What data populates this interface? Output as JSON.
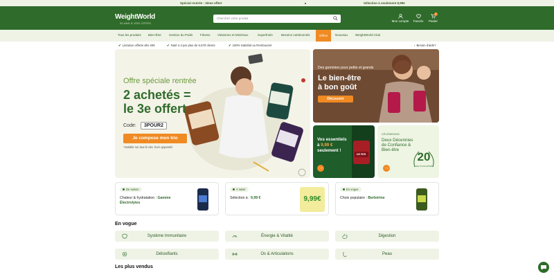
{
  "topbar": {
    "left": "Spécial rentrée : 3ème offert",
    "right": "Sélection à seulement 9,99€"
  },
  "header": {
    "logo": "WeightWorld",
    "logo_sub": "20 ANS À VOS CÔTÉS",
    "search_placeholder": "Cherchez votre produit",
    "account": "Mon compte",
    "favorites": "Favoris",
    "cart": "Panier",
    "cart_count": "0"
  },
  "nav": {
    "items": [
      "Tous les produits",
      "Bien-Être",
      "Gestion du Poids",
      "Fitness",
      "Vitamines et Minéraux",
      "Superfruits",
      "Besoins nutritionnels",
      "Offres",
      "Nouveau",
      "WeightWorld Club"
    ]
  },
  "usp": {
    "delivery": "Livraison offerte dès 40€",
    "rating": "Noté 4.4 par plus de 6,579 clients",
    "guarantee": "100% Satisfait ou Remboursé",
    "help": "Besoin d'aide?"
  },
  "hero": {
    "line1": "Offre spéciale rentrée",
    "line2": "2 achetés =",
    "line3": "le 3e offert",
    "code_label": "Code:",
    "code": "3POUR2",
    "cta": "Je compose mon trio",
    "valid": "*Valable sur tout le site, hors appareils"
  },
  "card1": {
    "small": "Des gummies pour petits et grands",
    "big1": "Le bien-être",
    "big2": "à bon goût",
    "cta": "Découvrir"
  },
  "card2": {
    "l1": "Vos essentiels",
    "l2": "à",
    "price": "9,99 €",
    "l3": "seulement !",
    "label": "DE FER"
  },
  "card3": {
    "small": "CÉLÉBRONS",
    "l1": "Deux Décennies",
    "l2": "de Confiance &",
    "l3": "Bien-être",
    "badge_num": "20",
    "badge_sub": "ANS À VOS CÔTÉS"
  },
  "promos": [
    {
      "tag": "De saison",
      "text_a": "Chaleur & hydratation : ",
      "text_b": "Gamme Électrolytes"
    },
    {
      "tag": "À saisir",
      "text_a": "Sélection à : ",
      "text_b": "9,99 €",
      "sticker": "9,99€"
    },
    {
      "tag": "En vogue",
      "text_a": "Choix populaire : ",
      "text_b": "Berbérine"
    }
  ],
  "trending_title": "En vogue",
  "categories": [
    "Système Immunitaire",
    "Énergie & Vitalité",
    "Digestion",
    "Détoxifiants",
    "Os & Articulations",
    "Peau"
  ],
  "bestsellers_title": "Les plus vendus",
  "colors": {
    "primary": "#2f6b2b",
    "accent": "#f08a23",
    "light": "#eef3e6"
  }
}
